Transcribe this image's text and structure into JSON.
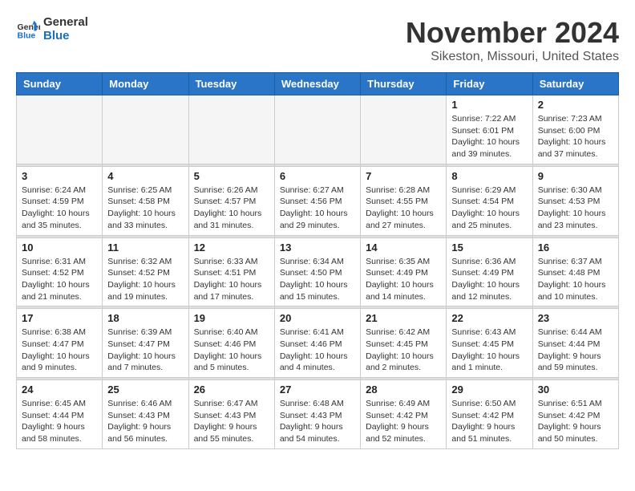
{
  "logo": {
    "text_general": "General",
    "text_blue": "Blue"
  },
  "title": "November 2024",
  "location": "Sikeston, Missouri, United States",
  "weekdays": [
    "Sunday",
    "Monday",
    "Tuesday",
    "Wednesday",
    "Thursday",
    "Friday",
    "Saturday"
  ],
  "weeks": [
    [
      {
        "day": "",
        "empty": true
      },
      {
        "day": "",
        "empty": true
      },
      {
        "day": "",
        "empty": true
      },
      {
        "day": "",
        "empty": true
      },
      {
        "day": "",
        "empty": true
      },
      {
        "day": "1",
        "sunrise": "Sunrise: 7:22 AM",
        "sunset": "Sunset: 6:01 PM",
        "daylight": "Daylight: 10 hours and 39 minutes."
      },
      {
        "day": "2",
        "sunrise": "Sunrise: 7:23 AM",
        "sunset": "Sunset: 6:00 PM",
        "daylight": "Daylight: 10 hours and 37 minutes."
      }
    ],
    [
      {
        "day": "3",
        "sunrise": "Sunrise: 6:24 AM",
        "sunset": "Sunset: 4:59 PM",
        "daylight": "Daylight: 10 hours and 35 minutes."
      },
      {
        "day": "4",
        "sunrise": "Sunrise: 6:25 AM",
        "sunset": "Sunset: 4:58 PM",
        "daylight": "Daylight: 10 hours and 33 minutes."
      },
      {
        "day": "5",
        "sunrise": "Sunrise: 6:26 AM",
        "sunset": "Sunset: 4:57 PM",
        "daylight": "Daylight: 10 hours and 31 minutes."
      },
      {
        "day": "6",
        "sunrise": "Sunrise: 6:27 AM",
        "sunset": "Sunset: 4:56 PM",
        "daylight": "Daylight: 10 hours and 29 minutes."
      },
      {
        "day": "7",
        "sunrise": "Sunrise: 6:28 AM",
        "sunset": "Sunset: 4:55 PM",
        "daylight": "Daylight: 10 hours and 27 minutes."
      },
      {
        "day": "8",
        "sunrise": "Sunrise: 6:29 AM",
        "sunset": "Sunset: 4:54 PM",
        "daylight": "Daylight: 10 hours and 25 minutes."
      },
      {
        "day": "9",
        "sunrise": "Sunrise: 6:30 AM",
        "sunset": "Sunset: 4:53 PM",
        "daylight": "Daylight: 10 hours and 23 minutes."
      }
    ],
    [
      {
        "day": "10",
        "sunrise": "Sunrise: 6:31 AM",
        "sunset": "Sunset: 4:52 PM",
        "daylight": "Daylight: 10 hours and 21 minutes."
      },
      {
        "day": "11",
        "sunrise": "Sunrise: 6:32 AM",
        "sunset": "Sunset: 4:52 PM",
        "daylight": "Daylight: 10 hours and 19 minutes."
      },
      {
        "day": "12",
        "sunrise": "Sunrise: 6:33 AM",
        "sunset": "Sunset: 4:51 PM",
        "daylight": "Daylight: 10 hours and 17 minutes."
      },
      {
        "day": "13",
        "sunrise": "Sunrise: 6:34 AM",
        "sunset": "Sunset: 4:50 PM",
        "daylight": "Daylight: 10 hours and 15 minutes."
      },
      {
        "day": "14",
        "sunrise": "Sunrise: 6:35 AM",
        "sunset": "Sunset: 4:49 PM",
        "daylight": "Daylight: 10 hours and 14 minutes."
      },
      {
        "day": "15",
        "sunrise": "Sunrise: 6:36 AM",
        "sunset": "Sunset: 4:49 PM",
        "daylight": "Daylight: 10 hours and 12 minutes."
      },
      {
        "day": "16",
        "sunrise": "Sunrise: 6:37 AM",
        "sunset": "Sunset: 4:48 PM",
        "daylight": "Daylight: 10 hours and 10 minutes."
      }
    ],
    [
      {
        "day": "17",
        "sunrise": "Sunrise: 6:38 AM",
        "sunset": "Sunset: 4:47 PM",
        "daylight": "Daylight: 10 hours and 9 minutes."
      },
      {
        "day": "18",
        "sunrise": "Sunrise: 6:39 AM",
        "sunset": "Sunset: 4:47 PM",
        "daylight": "Daylight: 10 hours and 7 minutes."
      },
      {
        "day": "19",
        "sunrise": "Sunrise: 6:40 AM",
        "sunset": "Sunset: 4:46 PM",
        "daylight": "Daylight: 10 hours and 5 minutes."
      },
      {
        "day": "20",
        "sunrise": "Sunrise: 6:41 AM",
        "sunset": "Sunset: 4:46 PM",
        "daylight": "Daylight: 10 hours and 4 minutes."
      },
      {
        "day": "21",
        "sunrise": "Sunrise: 6:42 AM",
        "sunset": "Sunset: 4:45 PM",
        "daylight": "Daylight: 10 hours and 2 minutes."
      },
      {
        "day": "22",
        "sunrise": "Sunrise: 6:43 AM",
        "sunset": "Sunset: 4:45 PM",
        "daylight": "Daylight: 10 hours and 1 minute."
      },
      {
        "day": "23",
        "sunrise": "Sunrise: 6:44 AM",
        "sunset": "Sunset: 4:44 PM",
        "daylight": "Daylight: 9 hours and 59 minutes."
      }
    ],
    [
      {
        "day": "24",
        "sunrise": "Sunrise: 6:45 AM",
        "sunset": "Sunset: 4:44 PM",
        "daylight": "Daylight: 9 hours and 58 minutes."
      },
      {
        "day": "25",
        "sunrise": "Sunrise: 6:46 AM",
        "sunset": "Sunset: 4:43 PM",
        "daylight": "Daylight: 9 hours and 56 minutes."
      },
      {
        "day": "26",
        "sunrise": "Sunrise: 6:47 AM",
        "sunset": "Sunset: 4:43 PM",
        "daylight": "Daylight: 9 hours and 55 minutes."
      },
      {
        "day": "27",
        "sunrise": "Sunrise: 6:48 AM",
        "sunset": "Sunset: 4:43 PM",
        "daylight": "Daylight: 9 hours and 54 minutes."
      },
      {
        "day": "28",
        "sunrise": "Sunrise: 6:49 AM",
        "sunset": "Sunset: 4:42 PM",
        "daylight": "Daylight: 9 hours and 52 minutes."
      },
      {
        "day": "29",
        "sunrise": "Sunrise: 6:50 AM",
        "sunset": "Sunset: 4:42 PM",
        "daylight": "Daylight: 9 hours and 51 minutes."
      },
      {
        "day": "30",
        "sunrise": "Sunrise: 6:51 AM",
        "sunset": "Sunset: 4:42 PM",
        "daylight": "Daylight: 9 hours and 50 minutes."
      }
    ]
  ]
}
